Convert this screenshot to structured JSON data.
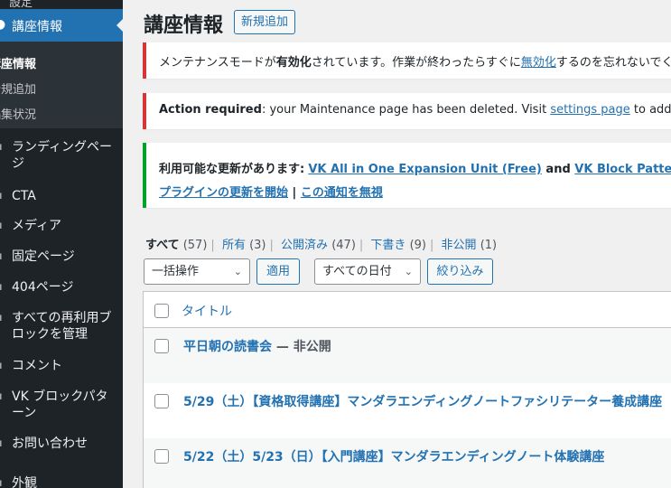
{
  "sidebar": {
    "top_cut_label": "設定",
    "active_label": "講座情報",
    "active_icon": "bullet",
    "submenu": [
      "講座情報",
      "新規追加",
      "編集状況"
    ],
    "items": [
      {
        "label": "ランディングページ"
      },
      {
        "label": "CTA"
      },
      {
        "label": "メディア"
      },
      {
        "label": "固定ページ"
      },
      {
        "label": "404ページ"
      },
      {
        "label": "すべての再利用ブロックを管理"
      },
      {
        "label": "コメント"
      },
      {
        "label": "VK ブロックパターン"
      },
      {
        "label": "お問い合わせ"
      },
      {
        "label": "外観"
      }
    ]
  },
  "header": {
    "title": "講座情報",
    "add_new": "新規追加"
  },
  "notices": {
    "maintenance": {
      "prefix": "メンテナンスモードが",
      "bold": "有効化",
      "mid": "されています。作業が終わったらすぐに",
      "link": "無効化",
      "suffix": "するのを忘れないでください。"
    },
    "action": {
      "bold": "Action required",
      "text": ": your Maintenance page has been deleted. Visit ",
      "link": "settings page",
      "suffix": " to address this issue."
    },
    "update": {
      "bold": "利用可能な更新があります:",
      "link1": "VK All in One Expansion Unit (Free)",
      "and": " and ",
      "link2": "VK Block Patterns",
      "end": "。",
      "action1": "プラグインの更新を開始",
      "sep": " | ",
      "action2": "この通知を無視"
    }
  },
  "filters": {
    "all": "すべて",
    "all_count": "(57)",
    "mine": "所有",
    "mine_count": "(3)",
    "published": "公開済み",
    "published_count": "(47)",
    "draft": "下書き",
    "draft_count": "(9)",
    "private": "非公開",
    "private_count": "(1)"
  },
  "toolbar": {
    "bulk": "一括操作",
    "apply": "適用",
    "dates": "すべての日付",
    "filter": "絞り込み"
  },
  "table": {
    "column_title": "タイトル",
    "rows": [
      {
        "title": "平日朝の読書会",
        "state": " — 非公開"
      },
      {
        "title": "5/29（土）【資格取得講座】マンダラエンディングノートファシリテーター養成講座",
        "state": ""
      },
      {
        "title": "5/22（土）5/23（日）【入門講座】マンダラエンディングノート体験講座",
        "state": ""
      }
    ]
  }
}
